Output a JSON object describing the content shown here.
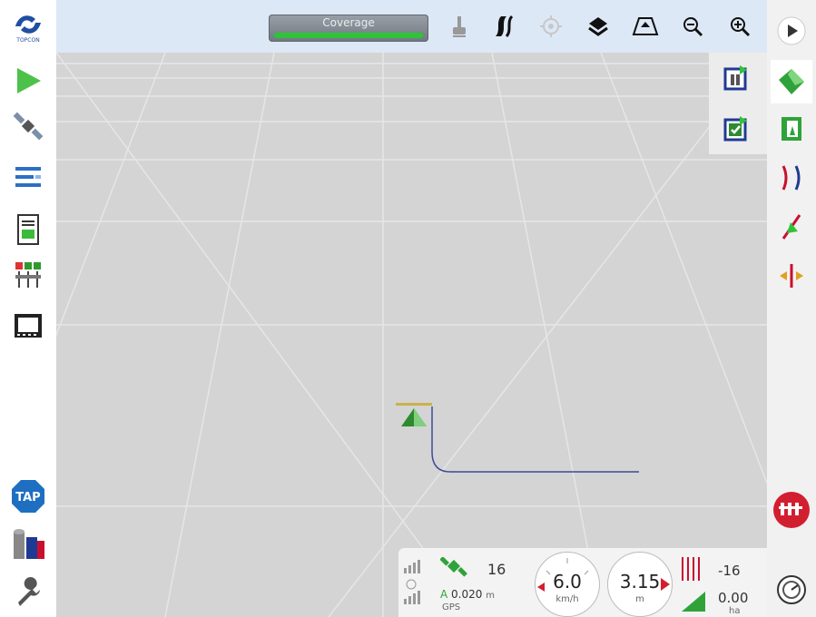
{
  "logo": {
    "text": "TOPCON"
  },
  "toolbar": {
    "coverage_label": "Coverage",
    "coverage_progress": 1.0
  },
  "left_buttons": [
    "play-triangle-icon",
    "satellite-icon",
    "list-lines-icon",
    "console-icon",
    "sections-icon",
    "video-icon",
    "tap-icon",
    "tanks-icon",
    "wrench-icon"
  ],
  "tap_label": "TAP",
  "top_icons": [
    "hand-icon",
    "road-curves-icon",
    "target-icon",
    "layers-icon",
    "perspective-icon",
    "zoom-out-icon",
    "zoom-in-icon"
  ],
  "status": {
    "satellites": "16",
    "accuracy": "0.020",
    "accuracy_unit": "m",
    "accuracy_prefix": "A",
    "source": "GPS",
    "speed": "6.0",
    "speed_unit": "km/h",
    "distance": "3.15",
    "distance_unit": "m",
    "offset": "-16",
    "area": "0.00",
    "area_unit": "ha"
  },
  "colors": {
    "accent_green": "#2fc23a",
    "topbar": "#dde8f6",
    "red": "#c8102e",
    "dark_blue": "#1f3a93"
  }
}
